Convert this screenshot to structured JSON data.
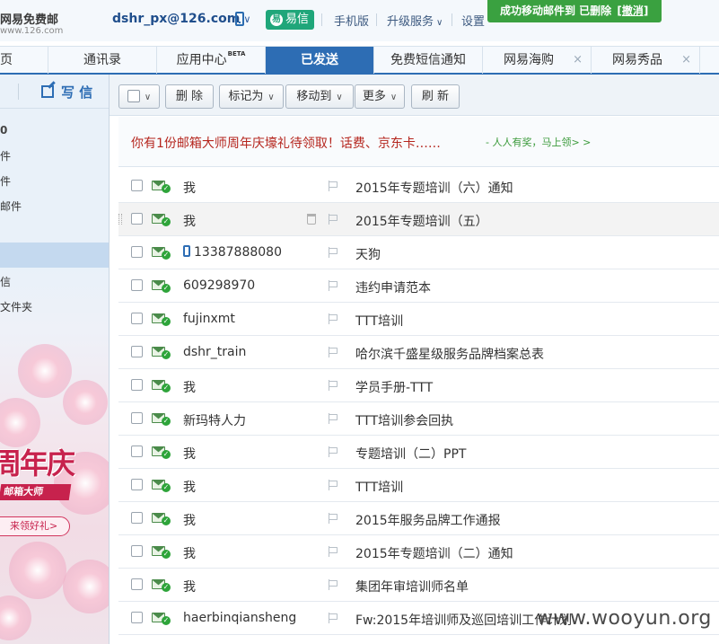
{
  "brand": {
    "name": "网易免费邮",
    "domain": "www.126.com"
  },
  "header": {
    "account": "dshr_px@126.com",
    "yixin_label": "易信",
    "links": {
      "mobile": "手机版",
      "upgrade": "升级服务",
      "settings": "设置"
    },
    "toast": {
      "message": "成功移动邮件到 已删除",
      "undo": "[撤消]"
    }
  },
  "tabs": [
    {
      "label": "页"
    },
    {
      "label": "通讯录"
    },
    {
      "label": "应用中心",
      "badge": "BETA"
    },
    {
      "label": "已发送",
      "active": true
    },
    {
      "label": "免费短信通知"
    },
    {
      "label": "网易海购",
      "close": "×"
    },
    {
      "label": "网易秀品",
      "close": "×"
    }
  ],
  "sidebar": {
    "write_label": "写 信",
    "items": [
      {
        "label": "0",
        "bold": true
      },
      {
        "label": "件"
      },
      {
        "label": "件"
      },
      {
        "label": "邮件"
      },
      {
        "label": "信"
      },
      {
        "label": "文件夹"
      }
    ],
    "promo": {
      "title": "周年庆",
      "subtitle": "邮箱大师",
      "button": "来领好礼>"
    }
  },
  "toolbar": {
    "delete": "删 除",
    "mark_as": "标记为",
    "move_to": "移动到",
    "more": "更多",
    "refresh": "刷 新"
  },
  "banner": {
    "text": "你有1份邮箱大师周年庆壕礼待领取！话费、京东卡……",
    "link": "- 人人有奖，马上领> >"
  },
  "mails": [
    {
      "from": "我",
      "subject": "2015年专题培训（六）通知"
    },
    {
      "from": "我",
      "subject": "2015年专题培训（五）"
    },
    {
      "from": "13387888080",
      "subject": "天狗",
      "mobile": true
    },
    {
      "from": "609298970",
      "subject": "违约申请范本"
    },
    {
      "from": "fujinxmt",
      "subject": "TTT培训"
    },
    {
      "from": "dshr_train",
      "subject": "哈尔滨千盛星级服务品牌档案总表"
    },
    {
      "from": "我",
      "subject": "学员手册-TTT"
    },
    {
      "from": "新玛特人力",
      "subject": "TTT培训参会回执"
    },
    {
      "from": "我",
      "subject": "专题培训（二）PPT"
    },
    {
      "from": "我",
      "subject": "TTT培训"
    },
    {
      "from": "我",
      "subject": "2015年服务品牌工作通报"
    },
    {
      "from": "我",
      "subject": "2015年专题培训（二）通知"
    },
    {
      "from": "我",
      "subject": "集团年审培训师名单"
    },
    {
      "from": "haerbinqiansheng",
      "subject": "Fw:2015年培训师及巡回培训工作计划"
    }
  ],
  "watermark": "www.wooyun.org",
  "colors": {
    "accent_blue": "#2d6db4",
    "toast_green": "#3aa140",
    "yixin_green": "#1fa67a",
    "banner_red": "#b5261e"
  }
}
